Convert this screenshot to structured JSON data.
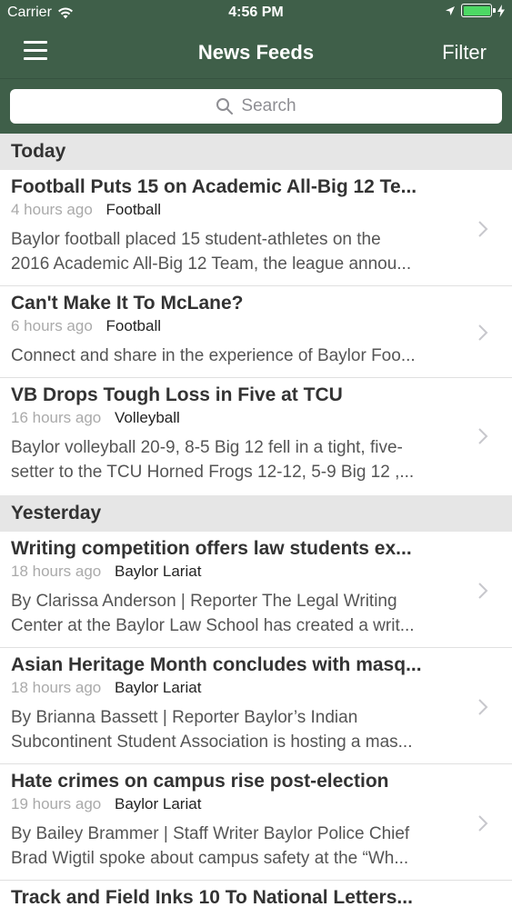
{
  "status_bar": {
    "carrier": "Carrier",
    "time": "4:56 PM"
  },
  "navbar": {
    "title": "News Feeds",
    "filter_label": "Filter"
  },
  "search": {
    "placeholder": "Search"
  },
  "sections": [
    {
      "header": "Today",
      "items": [
        {
          "title": "Football Puts 15 on Academic All-Big 12 Te...",
          "time": "4 hours ago",
          "category": "Football",
          "summary_lines": [
            "Baylor football placed 15 student-athletes on the",
            "2016 Academic All-Big 12 Team, the league annou..."
          ]
        },
        {
          "title": "Can't Make It To McLane?",
          "time": "6 hours ago",
          "category": "Football",
          "summary_lines": [
            "Connect and share in the experience of Baylor Foo..."
          ]
        },
        {
          "title": "VB Drops Tough Loss in Five at TCU",
          "time": "16 hours ago",
          "category": "Volleyball",
          "summary_lines": [
            "Baylor volleyball 20-9, 8-5 Big 12 fell in a tight, five-",
            "setter to the TCU Horned Frogs 12-12, 5-9 Big 12 ,..."
          ]
        }
      ]
    },
    {
      "header": "Yesterday",
      "items": [
        {
          "title": "Writing competition offers law students ex...",
          "time": "18 hours ago",
          "category": "Baylor Lariat",
          "summary_lines": [
            "By Clarissa Anderson | Reporter The Legal Writing",
            "Center at the Baylor Law School has created a writ..."
          ]
        },
        {
          "title": "Asian Heritage Month concludes with masq...",
          "time": "18 hours ago",
          "category": "Baylor Lariat",
          "summary_lines": [
            "By Brianna Bassett | Reporter Baylor’s Indian",
            "Subcontinent Student Association is hosting a mas..."
          ]
        },
        {
          "title": "Hate crimes on campus rise post-election",
          "time": "19 hours ago",
          "category": "Baylor Lariat",
          "summary_lines": [
            "By Bailey Brammer | Staff Writer Baylor Police Chief",
            "Brad Wigtil spoke about campus safety at the “Wh..."
          ]
        },
        {
          "title": "Track and Field Inks 10 To National Letters...",
          "time": "",
          "category": "",
          "summary_lines": []
        }
      ]
    }
  ],
  "colors": {
    "header_bg": "#3f5f49",
    "section_bg": "#e6e6e6",
    "battery": "#4cd964"
  }
}
